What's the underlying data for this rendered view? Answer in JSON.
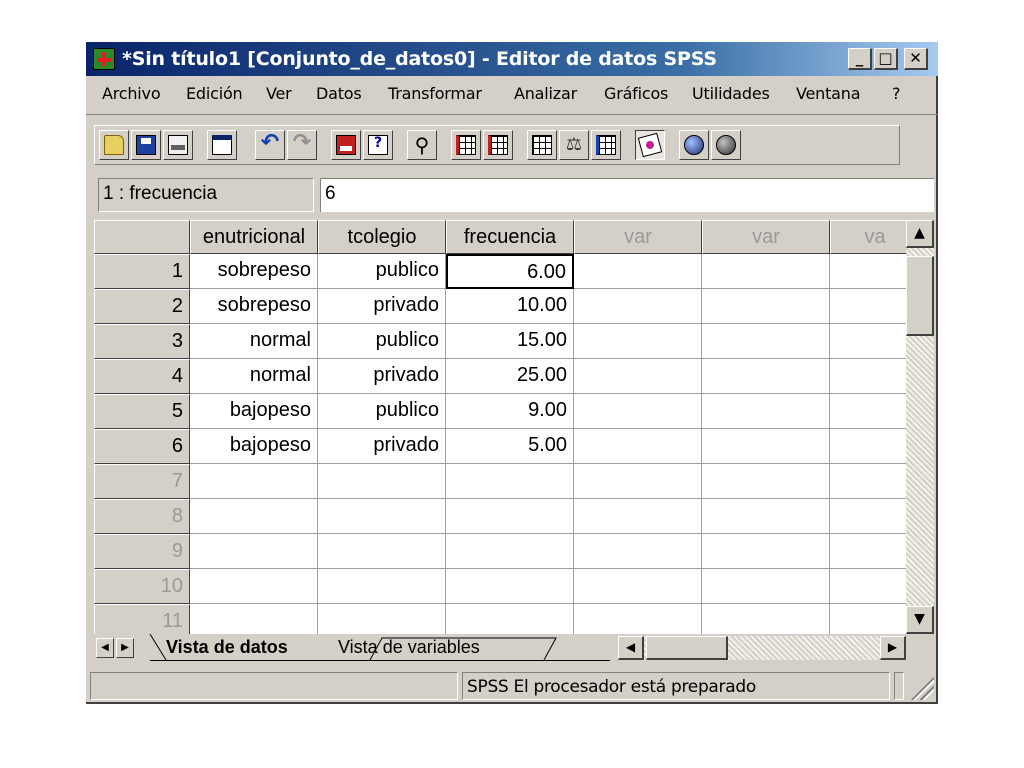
{
  "window": {
    "title": "*Sin título1 [Conjunto_de_datos0] - Editor de datos SPSS",
    "controls": {
      "minimize": "_",
      "maximize": "□",
      "close": "✕"
    }
  },
  "menu": [
    "Archivo",
    "Edición",
    "Ver",
    "Datos",
    "Transformar",
    "Analizar",
    "Gráficos",
    "Utilidades",
    "Ventana",
    "?"
  ],
  "toolbar": {
    "icons": [
      "open-folder-icon",
      "save-disk-icon",
      "print-icon",
      "dialog-recall-icon",
      "undo-icon",
      "redo-icon",
      "goto-case-icon",
      "variables-icon",
      "find-binoculars-icon",
      "insert-case-icon",
      "insert-variable-icon",
      "split-file-icon",
      "weight-cases-icon",
      "select-cases-icon",
      "value-labels-icon",
      "use-sets-icon",
      "show-all-icon"
    ]
  },
  "cell_editor": {
    "reference": "1 : frecuencia",
    "value": "6"
  },
  "grid": {
    "columns": [
      "enutricional",
      "tcolegio",
      "frecuencia",
      "var",
      "var",
      "va"
    ],
    "rows": [
      {
        "num": "1",
        "cells": [
          "sobrepeso",
          "publico",
          "6.00"
        ]
      },
      {
        "num": "2",
        "cells": [
          "sobrepeso",
          "privado",
          "10.00"
        ]
      },
      {
        "num": "3",
        "cells": [
          "normal",
          "publico",
          "15.00"
        ]
      },
      {
        "num": "4",
        "cells": [
          "normal",
          "privado",
          "25.00"
        ]
      },
      {
        "num": "5",
        "cells": [
          "bajopeso",
          "publico",
          "9.00"
        ]
      },
      {
        "num": "6",
        "cells": [
          "bajopeso",
          "privado",
          "5.00"
        ]
      },
      {
        "num": "7",
        "cells": [
          "",
          "",
          ""
        ]
      },
      {
        "num": "8",
        "cells": [
          "",
          "",
          ""
        ]
      },
      {
        "num": "9",
        "cells": [
          "",
          "",
          ""
        ]
      },
      {
        "num": "10",
        "cells": [
          "",
          "",
          ""
        ]
      },
      {
        "num": "11",
        "cells": [
          "",
          "",
          ""
        ]
      }
    ]
  },
  "tabs": {
    "data_view": "Vista de datos",
    "variable_view": "Vista de variables"
  },
  "status": {
    "text": "SPSS El procesador  está preparado"
  }
}
